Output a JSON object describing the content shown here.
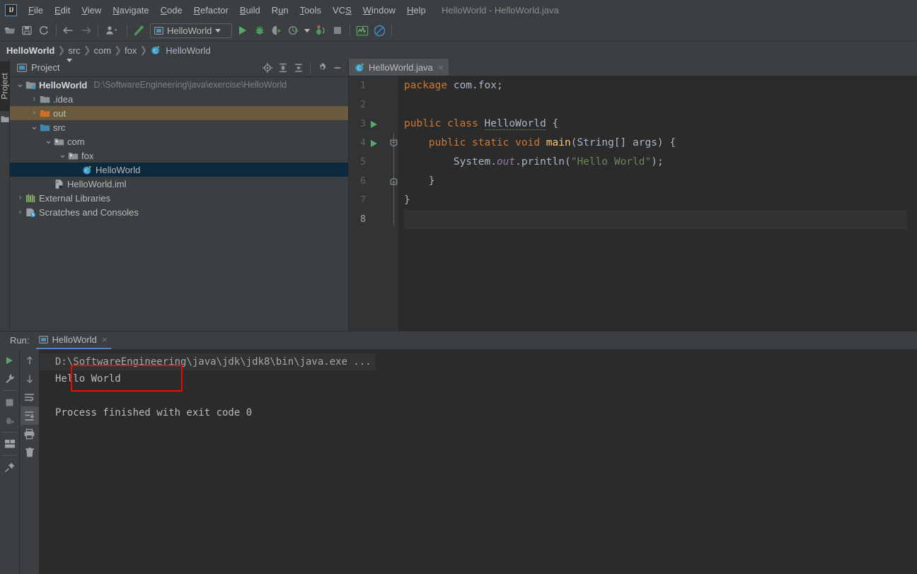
{
  "window": {
    "title": "HelloWorld - HelloWorld.java",
    "logo_text": "IJ"
  },
  "menubar": {
    "items": [
      {
        "label": "File",
        "mnemonic": "F"
      },
      {
        "label": "Edit",
        "mnemonic": "E"
      },
      {
        "label": "View",
        "mnemonic": "V"
      },
      {
        "label": "Navigate",
        "mnemonic": "N"
      },
      {
        "label": "Code",
        "mnemonic": "C"
      },
      {
        "label": "Refactor",
        "mnemonic": "R"
      },
      {
        "label": "Build",
        "mnemonic": "B"
      },
      {
        "label": "Run",
        "mnemonic": "u"
      },
      {
        "label": "Tools",
        "mnemonic": "T"
      },
      {
        "label": "VCS",
        "mnemonic": "S"
      },
      {
        "label": "Window",
        "mnemonic": "W"
      },
      {
        "label": "Help",
        "mnemonic": "H"
      }
    ]
  },
  "toolbar": {
    "open_label": "Open",
    "save_label": "Save All",
    "sync_label": "Synchronize",
    "back_label": "Back",
    "forward_label": "Forward",
    "vcs_label": "VCS operations",
    "build_label": "Build Project",
    "run_config": "HelloWorld",
    "run_label": "Run",
    "debug_label": "Debug",
    "coverage_label": "Run with Coverage",
    "profile_label": "Profile",
    "attach_label": "Attach to Process",
    "stop_label": "Stop",
    "monitor_label": "Performance Monitor",
    "disable_label": "Disable Inspections"
  },
  "breadcrumb": {
    "items": [
      {
        "label": "HelloWorld",
        "bold": true,
        "icon": ""
      },
      {
        "label": "src",
        "bold": false,
        "icon": ""
      },
      {
        "label": "com",
        "bold": false,
        "icon": ""
      },
      {
        "label": "fox",
        "bold": false,
        "icon": ""
      },
      {
        "label": "HelloWorld",
        "bold": false,
        "icon": "java-class-icon"
      }
    ],
    "separator": "❯"
  },
  "left_strip": {
    "project_tab": "Project"
  },
  "project_panel": {
    "title": "Project",
    "title_icon": "project-icon",
    "dropdown_icon": "chevron-down-icon",
    "toolbar": {
      "locate_label": "Select Opened File",
      "expand_label": "Expand All",
      "collapse_label": "Collapse All",
      "settings_label": "Settings",
      "hide_label": "Hide"
    },
    "tree": [
      {
        "label": "HelloWorld",
        "sub": "D:\\SoftwareEngineering\\java\\exercise\\HelloWorld",
        "depth": 0,
        "arrow": "expanded",
        "icon": "module-icon",
        "bold": true,
        "state": "none"
      },
      {
        "label": ".idea",
        "sub": "",
        "depth": 1,
        "arrow": "collapsed",
        "icon": "folder-icon",
        "bold": false,
        "state": "none"
      },
      {
        "label": "out",
        "sub": "",
        "depth": 1,
        "arrow": "collapsed",
        "icon": "folder-orange-icon",
        "bold": false,
        "state": "marked"
      },
      {
        "label": "src",
        "sub": "",
        "depth": 1,
        "arrow": "expanded",
        "icon": "folder-source-icon",
        "bold": false,
        "state": "none"
      },
      {
        "label": "com",
        "sub": "",
        "depth": 2,
        "arrow": "expanded",
        "icon": "package-icon",
        "bold": false,
        "state": "none"
      },
      {
        "label": "fox",
        "sub": "",
        "depth": 3,
        "arrow": "expanded",
        "icon": "package-icon",
        "bold": false,
        "state": "none"
      },
      {
        "label": "HelloWorld",
        "sub": "",
        "depth": 4,
        "arrow": "none",
        "icon": "java-class-icon",
        "bold": false,
        "state": "selected"
      },
      {
        "label": "HelloWorld.iml",
        "sub": "",
        "depth": 2,
        "arrow": "none",
        "icon": "iml-file-icon",
        "bold": false,
        "state": "none"
      },
      {
        "label": "External Libraries",
        "sub": "",
        "depth": 0,
        "arrow": "collapsed",
        "icon": "libraries-icon",
        "bold": false,
        "state": "none"
      },
      {
        "label": "Scratches and Consoles",
        "sub": "",
        "depth": 0,
        "arrow": "collapsed",
        "icon": "scratches-icon",
        "bold": false,
        "state": "none"
      }
    ]
  },
  "editor": {
    "tabs": [
      {
        "label": "HelloWorld.java",
        "icon": "java-class-icon",
        "close": "×",
        "active": true
      }
    ],
    "current_line": 8,
    "lines": [
      {
        "num": 1,
        "runnable": false,
        "fold": "none",
        "tokens": [
          {
            "t": "package ",
            "c": "kw"
          },
          {
            "t": "com.fox;",
            "c": "plain"
          }
        ]
      },
      {
        "num": 2,
        "runnable": false,
        "fold": "none",
        "tokens": []
      },
      {
        "num": 3,
        "runnable": true,
        "fold": "none",
        "tokens": [
          {
            "t": "public class ",
            "c": "kw"
          },
          {
            "t": "HelloWorld",
            "c": "cls-err"
          },
          {
            "t": " {",
            "c": "plain"
          }
        ]
      },
      {
        "num": 4,
        "runnable": true,
        "fold": "start",
        "tokens": [
          {
            "t": "    public static void ",
            "c": "kw"
          },
          {
            "t": "main",
            "c": "mth"
          },
          {
            "t": "(String[] args) {",
            "c": "plain"
          }
        ]
      },
      {
        "num": 5,
        "runnable": false,
        "fold": "bar",
        "tokens": [
          {
            "t": "        System.",
            "c": "plain"
          },
          {
            "t": "out",
            "c": "fld"
          },
          {
            "t": ".println(",
            "c": "plain"
          },
          {
            "t": "\"Hello World\"",
            "c": "str"
          },
          {
            "t": ");",
            "c": "plain"
          }
        ]
      },
      {
        "num": 6,
        "runnable": false,
        "fold": "end",
        "tokens": [
          {
            "t": "    }",
            "c": "plain"
          }
        ]
      },
      {
        "num": 7,
        "runnable": false,
        "fold": "none",
        "tokens": [
          {
            "t": "}",
            "c": "plain"
          }
        ]
      },
      {
        "num": 8,
        "runnable": false,
        "fold": "none",
        "tokens": []
      }
    ]
  },
  "run_panel": {
    "label": "Run:",
    "tab": {
      "label": "HelloWorld",
      "icon": "run-config-icon",
      "close": "×"
    },
    "left_tools": [
      {
        "name": "rerun-button",
        "label": "Rerun"
      },
      {
        "name": "settings-wrench-button",
        "label": "Edit Configuration"
      },
      {
        "name": "stop-button",
        "label": "Stop"
      },
      {
        "name": "restart-debug-button",
        "label": "Resume"
      },
      {
        "name": "layout-button",
        "label": "Layout Settings"
      },
      {
        "name": "pin-button",
        "label": "Pin Tab"
      }
    ],
    "right_tools": [
      {
        "name": "scroll-up-button",
        "label": "Up"
      },
      {
        "name": "scroll-down-button",
        "label": "Down"
      },
      {
        "name": "soft-wrap-button",
        "label": "Use Soft Wraps"
      },
      {
        "name": "scroll-to-end-button",
        "label": "Scroll to End",
        "active": true
      },
      {
        "name": "print-button",
        "label": "Print"
      },
      {
        "name": "clear-all-button",
        "label": "Clear All"
      }
    ],
    "console": {
      "command": "D:\\SoftwareEngineering\\java\\jdk\\jdk8\\bin\\java.exe ...",
      "output": "Hello World",
      "blank": "",
      "exit": "Process finished with exit code 0"
    },
    "annotation": {
      "type": "rectangle",
      "color": "#fa0000",
      "target": "Hello World"
    }
  },
  "colors": {
    "panel_bg": "#3c3f41",
    "editor_bg": "#2b2b2b",
    "gutter_bg": "#313335",
    "selection": "#0d293e",
    "marked_row": "#6b5b3c",
    "keyword": "#cc7832",
    "method": "#ffc66d",
    "field": "#9876aa",
    "string": "#6a8759",
    "plain_text": "#a9b7c6",
    "accent_green": "#59a869",
    "accent_blue": "#4a88c7",
    "annotation_red": "#fa0000"
  }
}
